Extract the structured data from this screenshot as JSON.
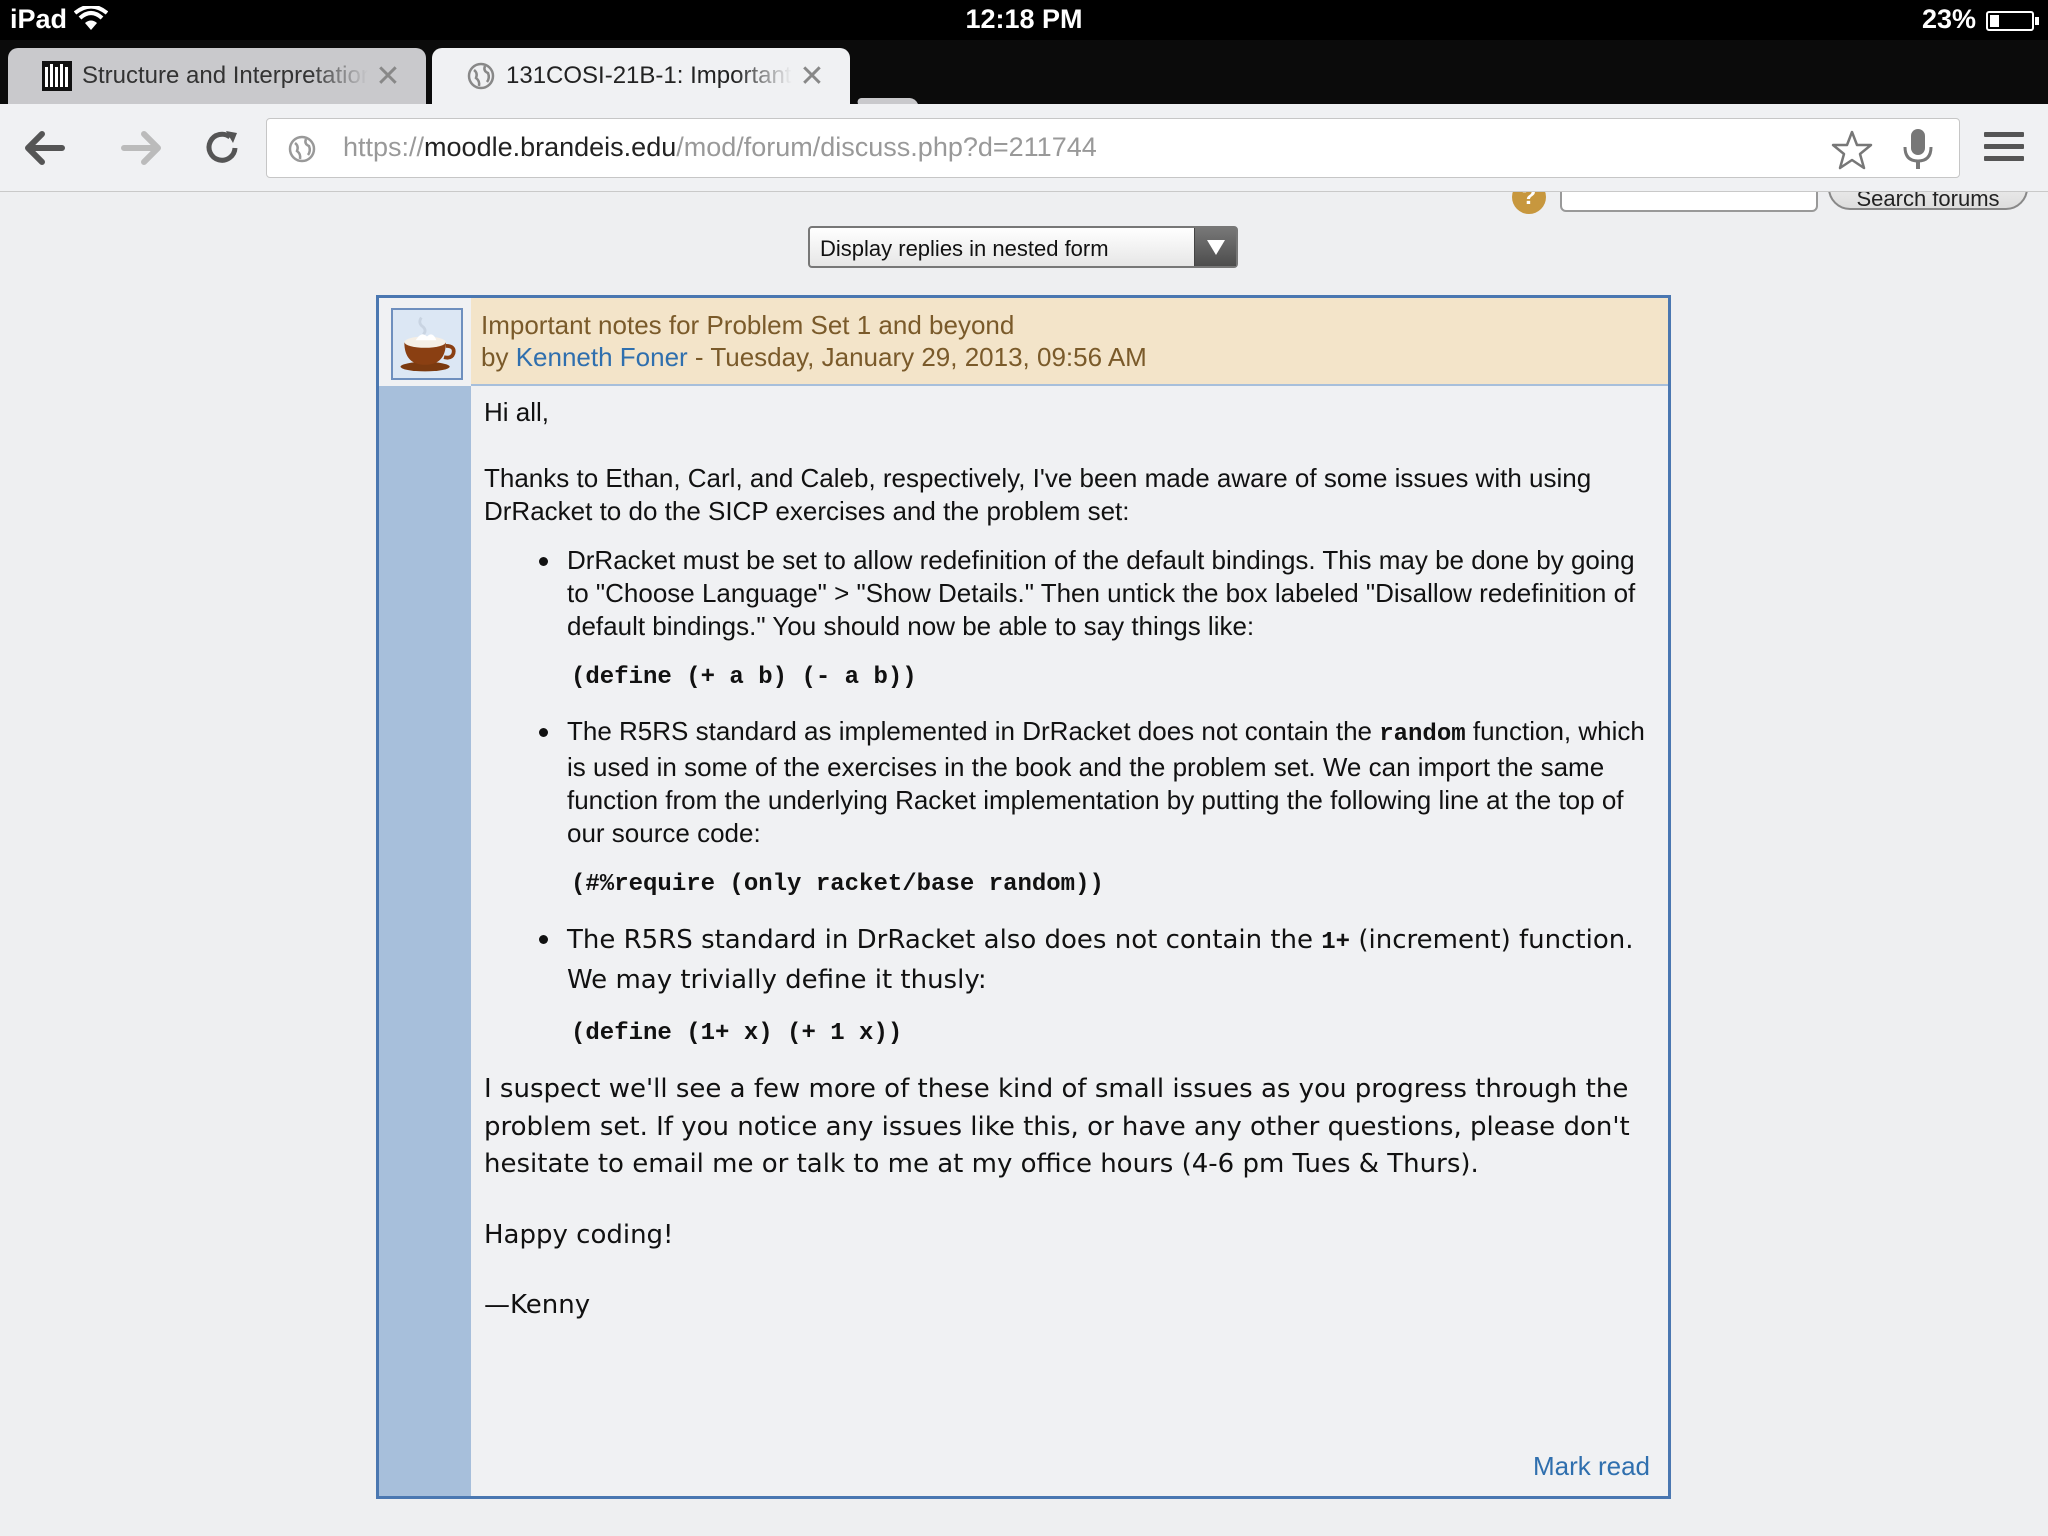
{
  "status_bar": {
    "device": "iPad",
    "time": "12:18 PM",
    "battery": "23%"
  },
  "tabs": [
    {
      "title": "Structure and Interpretation",
      "active": false,
      "favicon": "library-icon"
    },
    {
      "title": "131COSI-21B-1: Important",
      "active": true,
      "favicon": "globe-icon"
    }
  ],
  "toolbar": {
    "url_scheme": "https://",
    "url_host": "moodle.brandeis.edu",
    "url_path": "/mod/forum/discuss.php?d=211744"
  },
  "forum": {
    "search_button": "Search forums",
    "display_mode": "Display replies in nested form"
  },
  "post": {
    "subject": "Important notes for Problem Set 1 and beyond",
    "by_prefix": "by ",
    "author": "Kenneth Foner",
    "date": " - Tuesday, January 29, 2013, 09:56 AM",
    "greeting": "Hi all,",
    "intro": "Thanks to Ethan, Carl, and Caleb, respectively, I've been made aware of some issues with using DrRacket to do the SICP exercises and the problem set:",
    "bullet1": "DrRacket must be set to allow redefinition of the default bindings. This may be done by going to \"Choose Language\" > \"Show Details.\" Then untick the box labeled \"Disallow redefinition of default bindings.\" You should now be able to say things like:",
    "code1": "(define (+ a b) (- a b))",
    "bullet2_a": "The R5RS standard as implemented in DrRacket does not contain the ",
    "bullet2_code": "random",
    "bullet2_b": " function, which is used in some of the exercises in the book and the problem set. We can import the same function from the underlying Racket implementation by putting the following line at the top of our source code:",
    "code2": "(#%require (only racket/base random))",
    "bullet3_a": "The R5RS standard in DrRacket also does not contain the ",
    "bullet3_code": "1+",
    "bullet3_b": " (increment) function. We may trivially define it thusly:",
    "code3": "(define (1+ x) (+ 1 x))",
    "closing": "I suspect we'll see a few more of these kind of small issues as you progress through the problem set. If you notice any issues like this, or have any other questions, please don't hesitate to email me or talk to me at my office hours (4-6 pm Tues & Thurs).",
    "happy": "Happy coding!",
    "signature": "—Kenny",
    "mark_read": "Mark read"
  }
}
